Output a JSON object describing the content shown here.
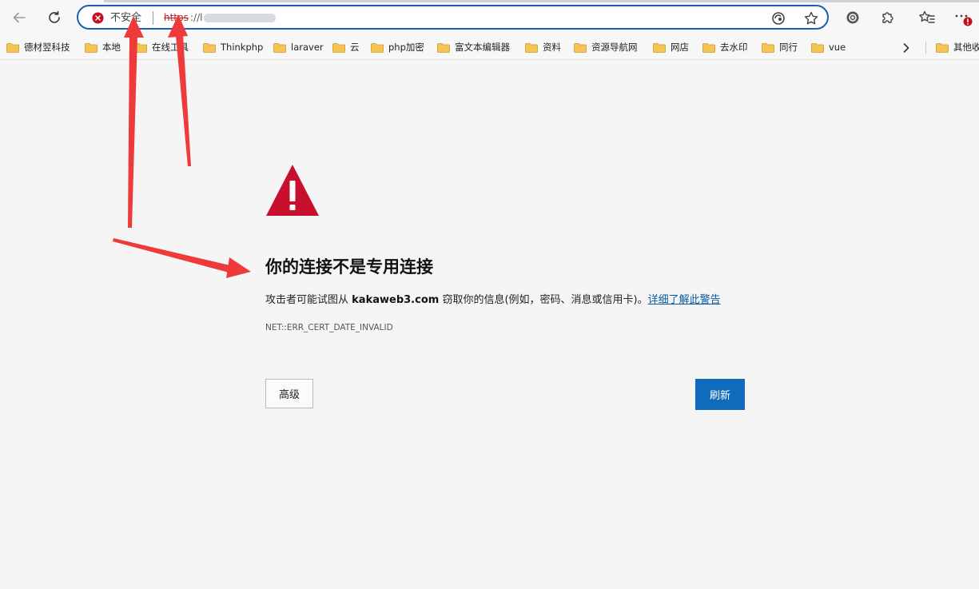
{
  "address_bar": {
    "security_label": "不安全",
    "url_scheme": "https",
    "url_rest": "://l"
  },
  "bookmarks": [
    {
      "label": "德材翌科技"
    },
    {
      "label": "本地"
    },
    {
      "label": "在线工具"
    },
    {
      "label": "Thinkphp"
    },
    {
      "label": "laraver"
    },
    {
      "label": "云"
    },
    {
      "label": "php加密"
    },
    {
      "label": "富文本编辑器"
    },
    {
      "label": "资料"
    },
    {
      "label": "资源导航网"
    },
    {
      "label": "网店"
    },
    {
      "label": "去水印"
    },
    {
      "label": "同行"
    },
    {
      "label": "vue"
    }
  ],
  "bookmarks_other": "其他收",
  "error_page": {
    "title": "你的连接不是专用连接",
    "desc_prefix": "攻击者可能试图从",
    "domain": "kakaweb3.com",
    "desc_suffix": "窃取你的信息(例如，密码、消息或信用卡)。",
    "learn_more": "详细了解此警告",
    "code": "NET::ERR_CERT_DATE_INVALID",
    "advanced_label": "高级",
    "refresh_label": "刷新"
  },
  "colors": {
    "accent": "#0f6cbd",
    "warning_red": "#c8102e",
    "annotation_red": "#ee3a3a"
  }
}
